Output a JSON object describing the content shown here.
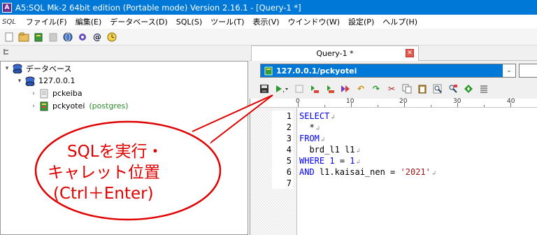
{
  "window": {
    "title": "A5:SQL Mk-2 64bit edition (Portable mode) Version 2.16.1 - [Query-1 *]"
  },
  "menu": {
    "logo": "SQL",
    "items": [
      "ファイル(F)",
      "編集(E)",
      "データベース(D)",
      "SQL(S)",
      "ツール(T)",
      "表示(V)",
      "ウインドウ(W)",
      "設定(P)",
      "ヘルプ(H)"
    ]
  },
  "tree": {
    "root": "データベース",
    "server": "127.0.0.1",
    "databases": [
      {
        "name": "pckeiba",
        "tag": ""
      },
      {
        "name": "pckyotei",
        "tag": "(postgres)"
      }
    ]
  },
  "tab": {
    "label": "Query-1 *",
    "close": "✕"
  },
  "connection": {
    "value": "127.0.0.1/pckyotei"
  },
  "ruler": {
    "labels": [
      "0",
      "10",
      "20",
      "30",
      "40"
    ]
  },
  "editor": {
    "line_numbers": [
      "1",
      "2",
      "3",
      "4",
      "5",
      "6",
      "7"
    ]
  },
  "callout": {
    "lines": [
      "SQLを実行・",
      "キャレット位置",
      "(Ctrl＋Enter)"
    ]
  },
  "colors": {
    "titlebar": "#0078d7",
    "callout": "#e00000",
    "keyword": "#0000ff",
    "string": "#a31515"
  }
}
